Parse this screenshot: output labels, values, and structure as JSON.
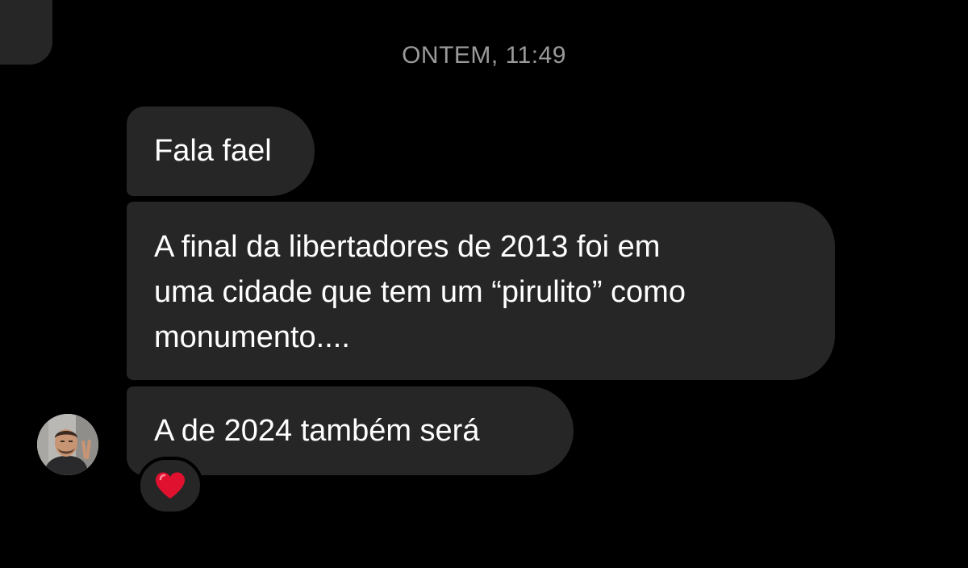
{
  "conversation": {
    "timestamp": "ONTEM, 11:49",
    "messages": [
      {
        "text": "Fala fael"
      },
      {
        "text": "A final da libertadores de 2013 foi em\numa cidade que tem um “pirulito” como\nmonumento...."
      },
      {
        "text": "A de 2024 também será"
      }
    ],
    "reaction": {
      "icon": "red-heart-icon",
      "color": "#e0112f"
    }
  },
  "colors": {
    "background": "#000000",
    "bubble": "#262626",
    "timestamp": "#9a9a9a",
    "text": "#ffffff"
  }
}
